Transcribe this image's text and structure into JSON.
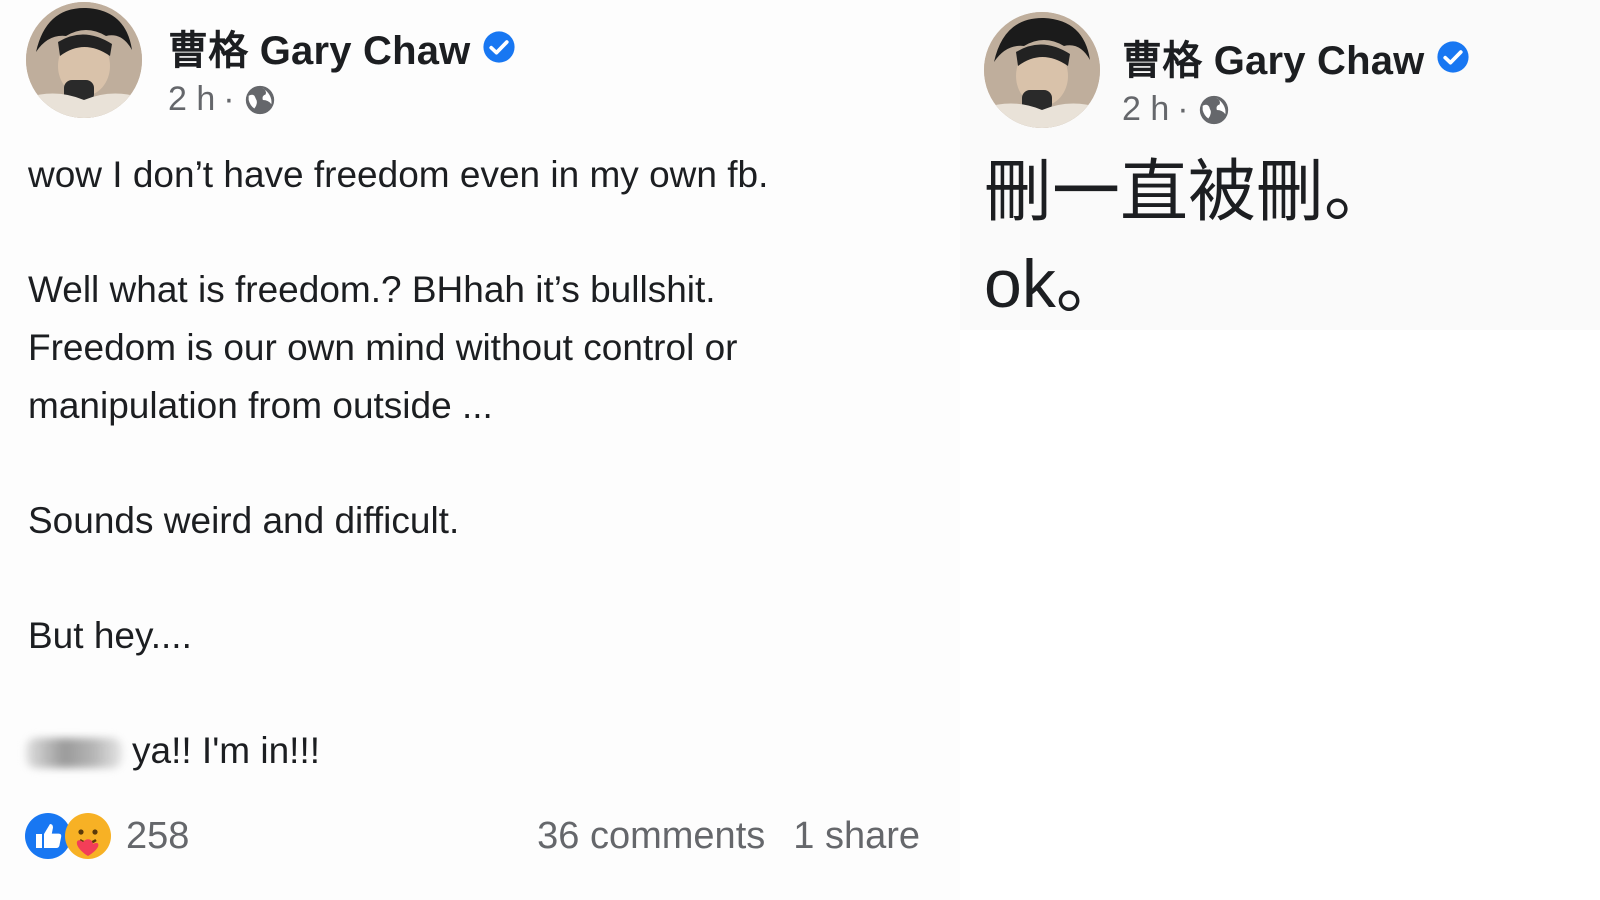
{
  "left_post": {
    "author": "曹格 Gary Chaw",
    "time": "2 h",
    "separator": "·",
    "lines": [
      "wow I don’t have freedom even in my own fb.",
      "Well what is freedom.? BHhah it’s bullshit.",
      "Freedom is our own mind without control or",
      "manipulation from outside ...",
      "Sounds weird and difficult.",
      "But hey....",
      "ya!! I'm in!!!"
    ],
    "reactions_count": "258",
    "comments": "36 comments",
    "shares": "1 share",
    "icons": {
      "verified": "verified-badge-icon",
      "audience": "globe-icon",
      "like": "like-reaction-icon",
      "care": "care-reaction-icon"
    }
  },
  "right_post": {
    "author": "曹格 Gary Chaw",
    "time": "2 h",
    "separator": "·",
    "lines": [
      "刪一直被刪。",
      "ok。"
    ]
  },
  "colors": {
    "verified_blue": "#1877f2",
    "secondary_text": "#65676b",
    "primary_text": "#1c1e21"
  }
}
